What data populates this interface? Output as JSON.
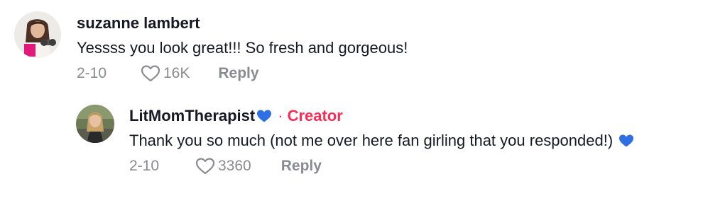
{
  "comment": {
    "author": "suzanne lambert",
    "text": "Yessss you look great!!! So fresh and gorgeous!",
    "date": "2-10",
    "likes": "16K",
    "reply_label": "Reply"
  },
  "reply": {
    "author": "LitMomTherapist",
    "author_emoji": "blue-heart-icon",
    "separator": "·",
    "badge": "Creator",
    "text": "Thank you so much (not me over here fan girling that you responded!)",
    "text_emoji": "blue-heart-icon",
    "date": "2-10",
    "likes": "3360",
    "reply_label": "Reply"
  },
  "colors": {
    "creator": "#FE2C55",
    "meta": "#8A8B91",
    "text": "#161823",
    "heart_emoji": "#2F6FE4"
  }
}
